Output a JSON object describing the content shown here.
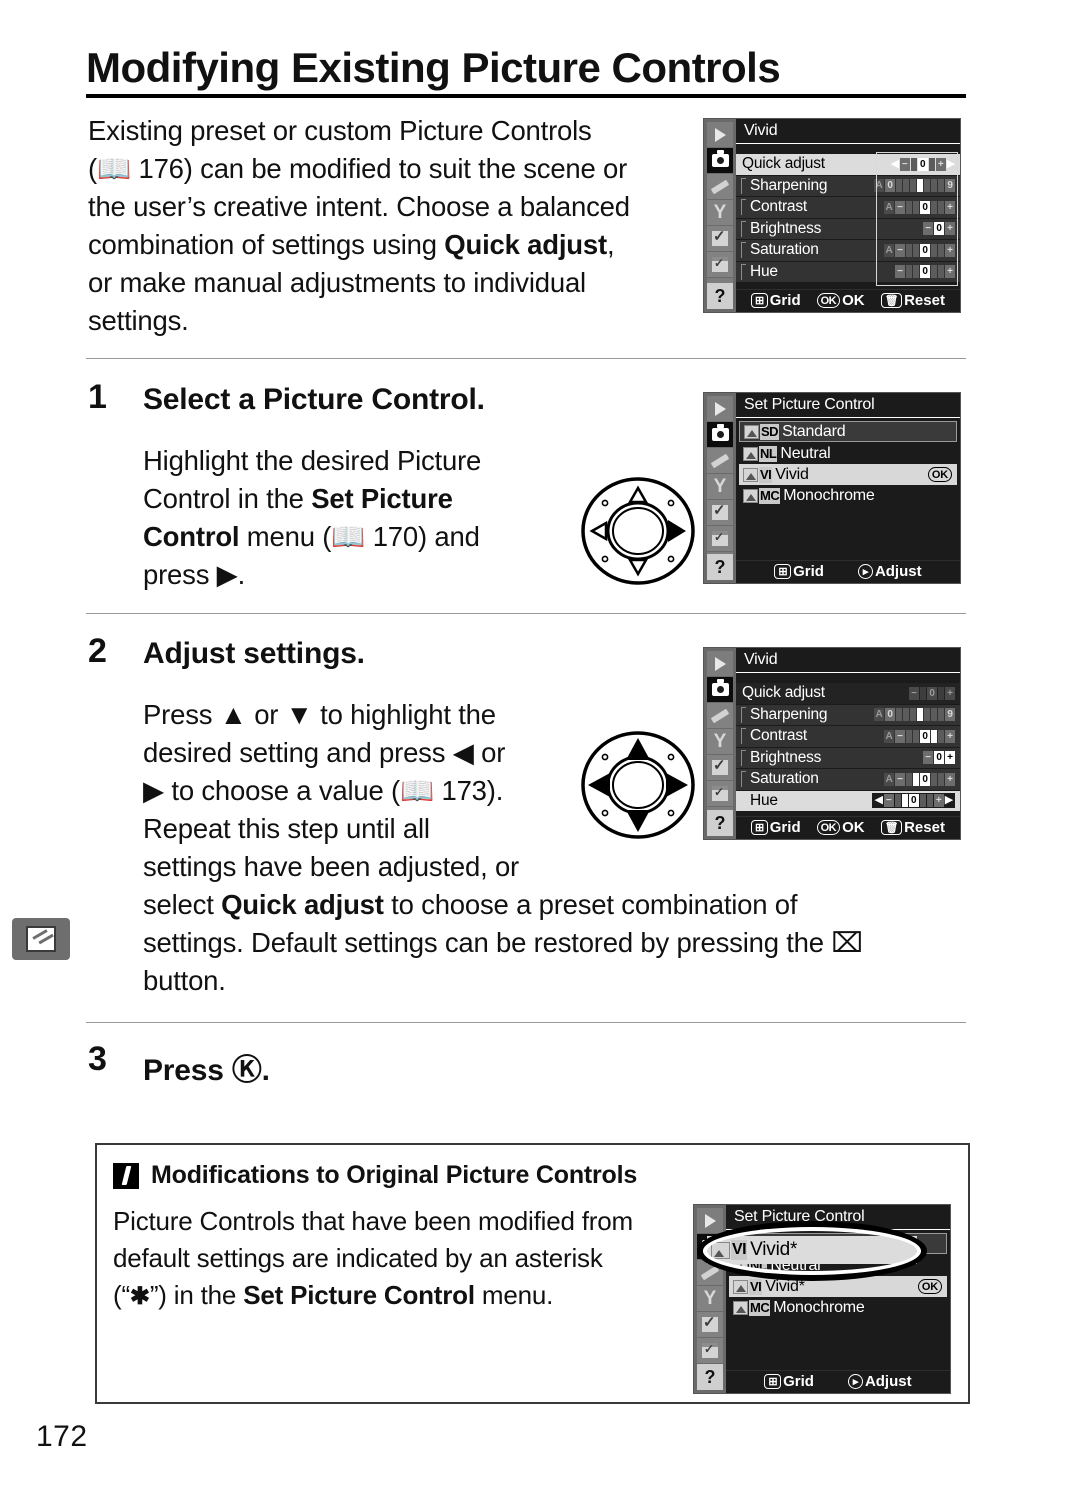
{
  "page": {
    "heading": "Modifying Existing Picture Controls",
    "folio": "172"
  },
  "intro": {
    "line1": "Existing preset or custom Picture Controls",
    "ref1": "176",
    "line2a": ") can be modified to suit the scene or",
    "line3": "the user’s creative intent.  Choose a balanced",
    "line4a": "combination of settings using ",
    "line4b": "Quick adjust",
    "line4c": ",",
    "line5": "or make manual adjustments to individual",
    "line6": "settings."
  },
  "steps": [
    {
      "num": "1",
      "title": "Select a Picture Control.",
      "body_a": "Highlight the desired Picture",
      "body_b": "Control in the ",
      "body_b_bold": "Set Picture",
      "body_c_bold": "Control",
      "body_c": " menu (",
      "body_ref": "170",
      "body_d": ") and",
      "body_e": "press ▶."
    },
    {
      "num": "2",
      "title": "Adjust settings.",
      "body_a": "Press ▲ or ▼ to highlight the",
      "body_b": "desired setting and press ◀ or",
      "body_c": "▶ to choose a value (",
      "body_ref": "173",
      "body_c2": ").",
      "body_d": "Repeat this step until all",
      "body_e": "settings have been adjusted, or",
      "wide_a": "select ",
      "wide_a_bold": "Quick adjust",
      "wide_b": " to choose a preset combination of",
      "wide_c": "settings.  Default settings can be restored by pressing the ⌧",
      "wide_d": "button."
    },
    {
      "num": "3",
      "title": "Press Ⓚ."
    }
  ],
  "note": {
    "title": "Modifications to Original Picture Controls",
    "line1": "Picture Controls that have been modified from",
    "line2": "default settings are indicated by an asterisk",
    "line3a": "(“",
    "line3_ast": "✱",
    "line3b": "”) in the ",
    "line3_bold": "Set Picture Control",
    "line3c": " menu."
  },
  "lcd_screens": {
    "vivid_default": {
      "title": "Vivid",
      "rows": [
        {
          "label": "Quick adjust",
          "selected": true,
          "indent": false
        },
        {
          "label": "Sharpening",
          "selected": false,
          "indent": true
        },
        {
          "label": "Contrast",
          "selected": false,
          "indent": true
        },
        {
          "label": "Brightness",
          "selected": false,
          "indent": true
        },
        {
          "label": "Saturation",
          "selected": false,
          "indent": true
        },
        {
          "label": "Hue",
          "selected": false,
          "indent": true
        }
      ],
      "footer": [
        {
          "key": "grid-icon",
          "label": "Grid"
        },
        {
          "key": "OK",
          "label": "OK"
        },
        {
          "key": "trash-icon",
          "label": "Reset"
        }
      ]
    },
    "set_picture_control": {
      "title": "Set Picture Control",
      "items": [
        {
          "tag": "SD",
          "label": "Standard",
          "state": "boxed",
          "ok": false
        },
        {
          "tag": "NL",
          "label": "Neutral",
          "state": "normal",
          "ok": false
        },
        {
          "tag": "VI",
          "label": "Vivid",
          "state": "selected",
          "ok": true
        },
        {
          "tag": "MC",
          "label": "Monochrome",
          "state": "normal",
          "ok": false
        }
      ],
      "ok_badge": "OK",
      "footer": [
        {
          "key": "grid-icon",
          "label": "Grid"
        },
        {
          "key": "dial-icon",
          "label": "Adjust"
        }
      ]
    },
    "vivid_adjusted": {
      "title": "Vivid",
      "rows": [
        {
          "label": "Quick adjust",
          "selected": false,
          "indent": false
        },
        {
          "label": "Sharpening",
          "selected": false,
          "indent": true
        },
        {
          "label": "Contrast",
          "selected": false,
          "indent": true
        },
        {
          "label": "Brightness",
          "selected": false,
          "indent": true
        },
        {
          "label": "Saturation",
          "selected": false,
          "indent": true
        },
        {
          "label": "Hue",
          "selected": true,
          "indent": true
        }
      ],
      "footer": [
        {
          "key": "grid-icon",
          "label": "Grid"
        },
        {
          "key": "OK",
          "label": "OK"
        },
        {
          "key": "trash-icon",
          "label": "Reset"
        }
      ]
    },
    "set_picture_control_modified": {
      "title": "Set Picture Control",
      "items": [
        {
          "tag": "SD",
          "label": "Standard",
          "state": "boxed",
          "ok": false
        },
        {
          "tag": "NL",
          "label": "Neutral",
          "state": "normal",
          "ok": false
        },
        {
          "tag": "VI",
          "label": "Vivid*",
          "state": "selected",
          "ok": true
        },
        {
          "tag": "MC",
          "label": "Monochrome",
          "state": "normal",
          "ok": false
        }
      ],
      "magnified_label": "Vivid*",
      "magnified_tag": "VI",
      "ok_badge": "OK",
      "footer": [
        {
          "key": "grid-icon",
          "label": "Grid"
        },
        {
          "key": "dial-icon",
          "label": "Adjust"
        }
      ]
    }
  },
  "colors": {
    "lcd_background": "#1b1b1b",
    "lcd_row": "#333333",
    "lcd_highlight": "#dcdcdc",
    "rail": "#6a6a6a",
    "text": "#111111",
    "rule": "#9a9a9a"
  }
}
